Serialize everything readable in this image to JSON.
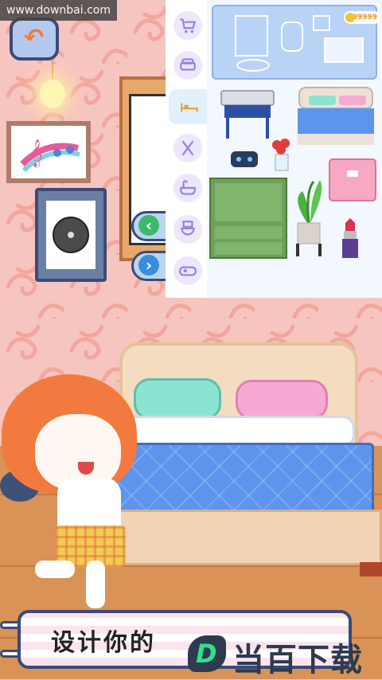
{
  "watermark": {
    "text": "www.downbai.com"
  },
  "coins": {
    "value": "99999"
  },
  "banner": {
    "text": "设计你的"
  },
  "logo": {
    "text": "当百下载",
    "mark": "D"
  },
  "categories": [
    {
      "name": "cart",
      "icon": "shopping-cart-icon"
    },
    {
      "name": "sofa",
      "icon": "sofa-icon"
    },
    {
      "name": "bed",
      "icon": "bed-icon",
      "selected": true
    },
    {
      "name": "kitchen",
      "icon": "kitchen-utensils-icon"
    },
    {
      "name": "bath",
      "icon": "bathtub-icon"
    },
    {
      "name": "toilet",
      "icon": "toilet-icon"
    },
    {
      "name": "games",
      "icon": "gamepad-icon"
    }
  ],
  "items": [
    {
      "name": "blue-desk"
    },
    {
      "name": "double-bed"
    },
    {
      "name": "robot-toy"
    },
    {
      "name": "flower-vase"
    },
    {
      "name": "pink-box"
    },
    {
      "name": "green-wardrobe"
    },
    {
      "name": "potted-plant"
    },
    {
      "name": "lipstick"
    }
  ],
  "colors": {
    "accent": "#3b4a78",
    "wall": "#f7c5c0",
    "floor": "#d99356",
    "panel": "#f3f7fe"
  }
}
